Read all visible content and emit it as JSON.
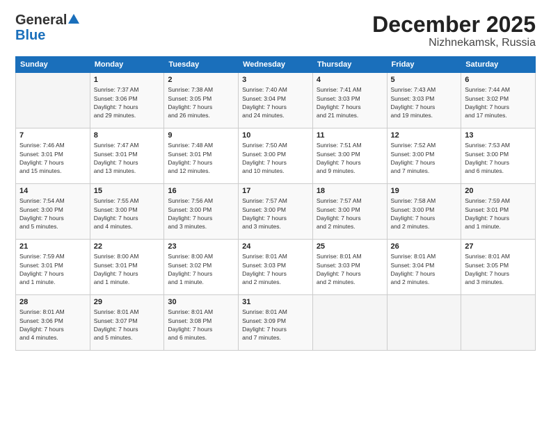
{
  "logo": {
    "line1": "General",
    "line2": "Blue"
  },
  "title": "December 2025",
  "location": "Nizhnekamsk, Russia",
  "header_days": [
    "Sunday",
    "Monday",
    "Tuesday",
    "Wednesday",
    "Thursday",
    "Friday",
    "Saturday"
  ],
  "weeks": [
    [
      {
        "day": "",
        "info": ""
      },
      {
        "day": "1",
        "info": "Sunrise: 7:37 AM\nSunset: 3:06 PM\nDaylight: 7 hours\nand 29 minutes."
      },
      {
        "day": "2",
        "info": "Sunrise: 7:38 AM\nSunset: 3:05 PM\nDaylight: 7 hours\nand 26 minutes."
      },
      {
        "day": "3",
        "info": "Sunrise: 7:40 AM\nSunset: 3:04 PM\nDaylight: 7 hours\nand 24 minutes."
      },
      {
        "day": "4",
        "info": "Sunrise: 7:41 AM\nSunset: 3:03 PM\nDaylight: 7 hours\nand 21 minutes."
      },
      {
        "day": "5",
        "info": "Sunrise: 7:43 AM\nSunset: 3:03 PM\nDaylight: 7 hours\nand 19 minutes."
      },
      {
        "day": "6",
        "info": "Sunrise: 7:44 AM\nSunset: 3:02 PM\nDaylight: 7 hours\nand 17 minutes."
      }
    ],
    [
      {
        "day": "7",
        "info": "Sunrise: 7:46 AM\nSunset: 3:01 PM\nDaylight: 7 hours\nand 15 minutes."
      },
      {
        "day": "8",
        "info": "Sunrise: 7:47 AM\nSunset: 3:01 PM\nDaylight: 7 hours\nand 13 minutes."
      },
      {
        "day": "9",
        "info": "Sunrise: 7:48 AM\nSunset: 3:01 PM\nDaylight: 7 hours\nand 12 minutes."
      },
      {
        "day": "10",
        "info": "Sunrise: 7:50 AM\nSunset: 3:00 PM\nDaylight: 7 hours\nand 10 minutes."
      },
      {
        "day": "11",
        "info": "Sunrise: 7:51 AM\nSunset: 3:00 PM\nDaylight: 7 hours\nand 9 minutes."
      },
      {
        "day": "12",
        "info": "Sunrise: 7:52 AM\nSunset: 3:00 PM\nDaylight: 7 hours\nand 7 minutes."
      },
      {
        "day": "13",
        "info": "Sunrise: 7:53 AM\nSunset: 3:00 PM\nDaylight: 7 hours\nand 6 minutes."
      }
    ],
    [
      {
        "day": "14",
        "info": "Sunrise: 7:54 AM\nSunset: 3:00 PM\nDaylight: 7 hours\nand 5 minutes."
      },
      {
        "day": "15",
        "info": "Sunrise: 7:55 AM\nSunset: 3:00 PM\nDaylight: 7 hours\nand 4 minutes."
      },
      {
        "day": "16",
        "info": "Sunrise: 7:56 AM\nSunset: 3:00 PM\nDaylight: 7 hours\nand 3 minutes."
      },
      {
        "day": "17",
        "info": "Sunrise: 7:57 AM\nSunset: 3:00 PM\nDaylight: 7 hours\nand 3 minutes."
      },
      {
        "day": "18",
        "info": "Sunrise: 7:57 AM\nSunset: 3:00 PM\nDaylight: 7 hours\nand 2 minutes."
      },
      {
        "day": "19",
        "info": "Sunrise: 7:58 AM\nSunset: 3:00 PM\nDaylight: 7 hours\nand 2 minutes."
      },
      {
        "day": "20",
        "info": "Sunrise: 7:59 AM\nSunset: 3:01 PM\nDaylight: 7 hours\nand 1 minute."
      }
    ],
    [
      {
        "day": "21",
        "info": "Sunrise: 7:59 AM\nSunset: 3:01 PM\nDaylight: 7 hours\nand 1 minute."
      },
      {
        "day": "22",
        "info": "Sunrise: 8:00 AM\nSunset: 3:01 PM\nDaylight: 7 hours\nand 1 minute."
      },
      {
        "day": "23",
        "info": "Sunrise: 8:00 AM\nSunset: 3:02 PM\nDaylight: 7 hours\nand 1 minute."
      },
      {
        "day": "24",
        "info": "Sunrise: 8:01 AM\nSunset: 3:03 PM\nDaylight: 7 hours\nand 2 minutes."
      },
      {
        "day": "25",
        "info": "Sunrise: 8:01 AM\nSunset: 3:03 PM\nDaylight: 7 hours\nand 2 minutes."
      },
      {
        "day": "26",
        "info": "Sunrise: 8:01 AM\nSunset: 3:04 PM\nDaylight: 7 hours\nand 2 minutes."
      },
      {
        "day": "27",
        "info": "Sunrise: 8:01 AM\nSunset: 3:05 PM\nDaylight: 7 hours\nand 3 minutes."
      }
    ],
    [
      {
        "day": "28",
        "info": "Sunrise: 8:01 AM\nSunset: 3:06 PM\nDaylight: 7 hours\nand 4 minutes."
      },
      {
        "day": "29",
        "info": "Sunrise: 8:01 AM\nSunset: 3:07 PM\nDaylight: 7 hours\nand 5 minutes."
      },
      {
        "day": "30",
        "info": "Sunrise: 8:01 AM\nSunset: 3:08 PM\nDaylight: 7 hours\nand 6 minutes."
      },
      {
        "day": "31",
        "info": "Sunrise: 8:01 AM\nSunset: 3:09 PM\nDaylight: 7 hours\nand 7 minutes."
      },
      {
        "day": "",
        "info": ""
      },
      {
        "day": "",
        "info": ""
      },
      {
        "day": "",
        "info": ""
      }
    ]
  ]
}
